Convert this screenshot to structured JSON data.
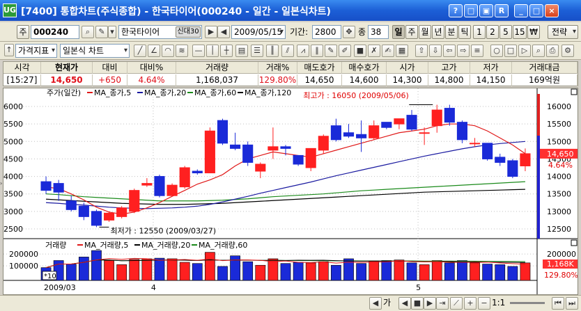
{
  "window": {
    "title": "[7400] 통합차트(주식종합) - 한국타이어(000240 - 일간 - 일본식차트)",
    "app_badge": "UG",
    "buttons": [
      "?",
      "□",
      "▣",
      "R",
      "_",
      "□",
      "×"
    ]
  },
  "toolbar1": {
    "market_label": "주",
    "code": "000240",
    "name": "한국타이어",
    "badge": "신대30",
    "date": "2009/05/15",
    "period_label": "기간:",
    "period_value": "2800",
    "count_label": "종",
    "count_value": "38",
    "timeframes": [
      "일",
      "주",
      "월",
      "년",
      "분",
      "틱",
      "1",
      "2",
      "5",
      "15",
      "₩"
    ],
    "selected_timeframe": "일",
    "strategy_label": "전략"
  },
  "toolbar2": {
    "indicator_label": "가격지표",
    "chart_type": "일본식 차트"
  },
  "quote": {
    "headers": [
      "시각",
      "현재가",
      "대비",
      "대비%",
      "거래량",
      "거래%",
      "매도호가",
      "매수호가",
      "시가",
      "고가",
      "저가",
      "거래대금"
    ],
    "values": [
      "[15:27]",
      "14,650",
      "+650",
      "4.64%",
      "1,168,037",
      "129.80%",
      "14,650",
      "14,600",
      "14,300",
      "14,800",
      "14,150",
      "169억원"
    ]
  },
  "price_panel": {
    "legend": {
      "title": "주가(일간)",
      "ma5": "MA_종가,5",
      "ma20": "MA_종가,20",
      "ma60": "MA_종가,60",
      "ma120": "MA_종가,120"
    },
    "high_note": "최고가 : 16050 (2009/05/06)",
    "low_note": "최저가 : 12550 (2009/03/27)",
    "last_price_tag": "14,650",
    "last_pct_tag": "4.64%"
  },
  "volume_panel": {
    "legend": {
      "title": "거래량",
      "ma5": "MA_거래량,5",
      "ma20": "MA_거래량,20",
      "ma60": "MA_거래량,60"
    },
    "unit_tag": "*10",
    "last_vol_tag": "1,168K",
    "last_pct_tag": "129.80%"
  },
  "x_labels": [
    "2009/03",
    "4",
    "5"
  ],
  "colors": {
    "up": "#ff2020",
    "down": "#1a2ad8",
    "ma5": "#e01818",
    "ma20": "#1a1aa0",
    "ma60": "#1a8a1a",
    "ma120": "#000000"
  },
  "chart_data": {
    "type": "candlestick",
    "ylim": [
      12300,
      16200
    ],
    "yticks": [
      12500,
      13000,
      13500,
      14000,
      14500,
      15000,
      15500,
      16000
    ],
    "candles": [
      {
        "o": 13850,
        "h": 14000,
        "l": 13500,
        "c": 13600
      },
      {
        "o": 13800,
        "h": 13900,
        "l": 13300,
        "c": 13550
      },
      {
        "o": 13300,
        "h": 13450,
        "l": 13000,
        "c": 13050
      },
      {
        "o": 13150,
        "h": 13250,
        "l": 12750,
        "c": 12850
      },
      {
        "o": 13000,
        "h": 13050,
        "l": 12550,
        "c": 12600
      },
      {
        "o": 12750,
        "h": 13000,
        "l": 12700,
        "c": 12950
      },
      {
        "o": 12850,
        "h": 13150,
        "l": 12800,
        "c": 13100
      },
      {
        "o": 13000,
        "h": 13650,
        "l": 12950,
        "c": 13600
      },
      {
        "o": 13750,
        "h": 13950,
        "l": 13700,
        "c": 13800
      },
      {
        "o": 14000,
        "h": 14050,
        "l": 13400,
        "c": 13450
      },
      {
        "o": 13450,
        "h": 13800,
        "l": 13450,
        "c": 13750
      },
      {
        "o": 13700,
        "h": 14300,
        "l": 13650,
        "c": 14250
      },
      {
        "o": 14150,
        "h": 14200,
        "l": 14050,
        "c": 14100
      },
      {
        "o": 14100,
        "h": 15400,
        "l": 14100,
        "c": 15300
      },
      {
        "o": 15600,
        "h": 15650,
        "l": 14900,
        "c": 14950
      },
      {
        "o": 14900,
        "h": 15250,
        "l": 14750,
        "c": 14800
      },
      {
        "o": 14900,
        "h": 15000,
        "l": 14300,
        "c": 14400
      },
      {
        "o": 14150,
        "h": 14400,
        "l": 13950,
        "c": 14350
      },
      {
        "o": 14750,
        "h": 15400,
        "l": 14500,
        "c": 14850
      },
      {
        "o": 14850,
        "h": 14900,
        "l": 14600,
        "c": 14800
      },
      {
        "o": 14600,
        "h": 14600,
        "l": 14300,
        "c": 14350
      },
      {
        "o": 14250,
        "h": 14800,
        "l": 14150,
        "c": 14800
      },
      {
        "o": 14750,
        "h": 15200,
        "l": 14650,
        "c": 15150
      },
      {
        "o": 15450,
        "h": 15650,
        "l": 15000,
        "c": 15050
      },
      {
        "o": 15250,
        "h": 15500,
        "l": 15100,
        "c": 15150
      },
      {
        "o": 15200,
        "h": 15600,
        "l": 14700,
        "c": 15100
      },
      {
        "o": 15100,
        "h": 15600,
        "l": 15050,
        "c": 15450
      },
      {
        "o": 15550,
        "h": 15550,
        "l": 15350,
        "c": 15400
      },
      {
        "o": 15500,
        "h": 15650,
        "l": 15350,
        "c": 15650
      },
      {
        "o": 15750,
        "h": 15900,
        "l": 15300,
        "c": 15350
      },
      {
        "o": 15250,
        "h": 15400,
        "l": 14900,
        "c": 15250
      },
      {
        "o": 15450,
        "h": 16050,
        "l": 15250,
        "c": 15900
      },
      {
        "o": 15950,
        "h": 16050,
        "l": 15450,
        "c": 15550
      },
      {
        "o": 15550,
        "h": 15600,
        "l": 14950,
        "c": 15050
      },
      {
        "o": 14950,
        "h": 15100,
        "l": 14850,
        "c": 14950
      },
      {
        "o": 14950,
        "h": 14950,
        "l": 14450,
        "c": 14500
      },
      {
        "o": 14550,
        "h": 14650,
        "l": 14300,
        "c": 14400
      },
      {
        "o": 14450,
        "h": 14500,
        "l": 13950,
        "c": 14000
      },
      {
        "o": 14300,
        "h": 14800,
        "l": 14150,
        "c": 14650
      }
    ],
    "ma5": [
      13700,
      13650,
      13500,
      13330,
      13120,
      12980,
      12920,
      12980,
      13100,
      13250,
      13430,
      13600,
      13780,
      13900,
      14050,
      14300,
      14500,
      14600,
      14700,
      14650,
      14600,
      14550,
      14650,
      14750,
      14850,
      14950,
      15050,
      15150,
      15250,
      15300,
      15350,
      15450,
      15500,
      15500,
      15450,
      15300,
      15100,
      14900,
      14650
    ],
    "ma20": [
      13250,
      13230,
      13200,
      13180,
      13150,
      13120,
      13100,
      13090,
      13080,
      13090,
      13100,
      13120,
      13150,
      13200,
      13270,
      13350,
      13430,
      13520,
      13600,
      13680,
      13760,
      13840,
      13930,
      14020,
      14100,
      14180,
      14260,
      14340,
      14420,
      14500,
      14580,
      14650,
      14720,
      14790,
      14850,
      14900,
      14940,
      14970,
      15000
    ],
    "ma60": [
      13500,
      13480,
      13450,
      13420,
      13400,
      13380,
      13360,
      13340,
      13320,
      13300,
      13300,
      13300,
      13300,
      13310,
      13320,
      13340,
      13360,
      13390,
      13420,
      13440,
      13460,
      13480,
      13500,
      13530,
      13560,
      13590,
      13610,
      13630,
      13650,
      13670,
      13690,
      13710,
      13730,
      13750,
      13770,
      13790,
      13810,
      13830,
      13850
    ],
    "ma120": [
      13350,
      13330,
      13310,
      13290,
      13270,
      13250,
      13230,
      13220,
      13210,
      13200,
      13200,
      13200,
      13210,
      13220,
      13230,
      13250,
      13270,
      13290,
      13310,
      13330,
      13350,
      13370,
      13390,
      13410,
      13430,
      13450,
      13470,
      13490,
      13510,
      13530,
      13550,
      13560,
      13570,
      13580,
      13590,
      13600,
      13610,
      13620,
      13630
    ],
    "volumes": [
      85,
      145,
      115,
      175,
      230,
      145,
      110,
      155,
      160,
      165,
      160,
      130,
      120,
      215,
      95,
      185,
      135,
      105,
      160,
      120,
      130,
      125,
      135,
      105,
      160,
      120,
      140,
      145,
      150,
      125,
      110,
      145,
      125,
      145,
      125,
      115,
      110,
      95,
      125
    ],
    "vol_ylim": [
      0,
      260
    ],
    "vol_yticks": [
      100000,
      200000
    ]
  }
}
